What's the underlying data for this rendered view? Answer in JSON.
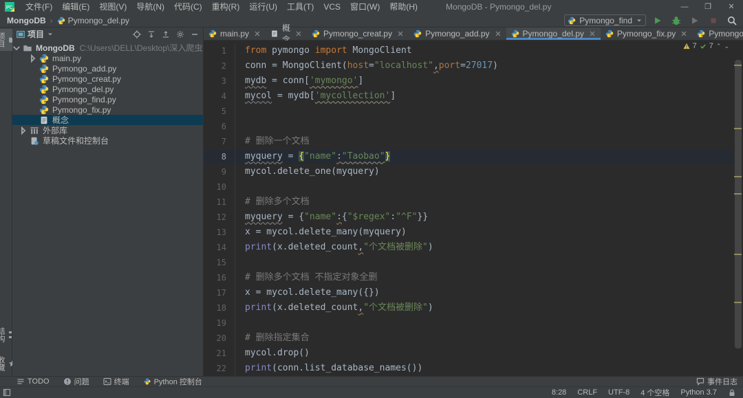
{
  "colors": {
    "accent_blue": "#4a88c7",
    "run_green": "#499c54",
    "selection_blue": "#0d3c52",
    "keyword_orange": "#cc7832",
    "string_green": "#6a8759",
    "number_blue": "#6897bb",
    "builtin_purple": "#8888c6",
    "brace_match_yellow": "#ffef28"
  },
  "titlebar": {
    "title": "MongoDB - Pymongo_del.py",
    "menus": [
      "文件(F)",
      "编辑(E)",
      "视图(V)",
      "导航(N)",
      "代码(C)",
      "重构(R)",
      "运行(U)",
      "工具(T)",
      "VCS",
      "窗口(W)",
      "帮助(H)"
    ],
    "window_controls": {
      "minimize": "—",
      "maximize": "❐",
      "close": "✕"
    }
  },
  "navbar": {
    "crumb_root": "MongoDB",
    "crumb_file": "Pymongo_del.py",
    "run_config": "Pymongo_find"
  },
  "left_stripe": {
    "top": [
      {
        "label": "项目",
        "icon": "folder-icon",
        "active": true
      }
    ],
    "bottom": [
      {
        "label": "结构",
        "icon": "structure-icon"
      },
      {
        "label": "收藏",
        "icon": "star-icon"
      }
    ]
  },
  "project_panel": {
    "header": "项目",
    "tree": [
      {
        "label": "MongoDB",
        "bold": true,
        "path": "C:\\Users\\DELL\\Desktop\\深入爬虫\\爬虫\\MongoDB",
        "icon": "folder-icon",
        "arrow": "down",
        "indent": 2
      },
      {
        "label": "main.py",
        "icon": "python-file-icon",
        "arrow": "right",
        "indent": 26
      },
      {
        "label": "Pymongo_add.py",
        "icon": "python-file-icon",
        "arrow": "none",
        "indent": 26
      },
      {
        "label": "Pymongo_creat.py",
        "icon": "python-file-icon",
        "arrow": "none",
        "indent": 26
      },
      {
        "label": "Pymongo_del.py",
        "icon": "python-file-icon",
        "arrow": "none",
        "indent": 26
      },
      {
        "label": "Pymongo_find.py",
        "icon": "python-file-icon",
        "arrow": "none",
        "indent": 26
      },
      {
        "label": "Pymongo_fix.py",
        "icon": "python-file-icon",
        "arrow": "none",
        "indent": 26
      },
      {
        "label": "概念",
        "icon": "text-file-icon",
        "arrow": "none",
        "indent": 26,
        "selected": true
      },
      {
        "label": "外部库",
        "icon": "library-icon",
        "arrow": "right",
        "indent": 12
      },
      {
        "label": "草稿文件和控制台",
        "icon": "scratch-icon",
        "arrow": "none",
        "indent": 12
      }
    ]
  },
  "tabs": [
    {
      "label": "main.py",
      "icon": "python-file-icon"
    },
    {
      "label": "概念",
      "icon": "text-file-icon"
    },
    {
      "label": "Pymongo_creat.py",
      "icon": "python-file-icon"
    },
    {
      "label": "Pymongo_add.py",
      "icon": "python-file-icon"
    },
    {
      "label": "Pymongo_del.py",
      "icon": "python-file-icon",
      "active": true
    },
    {
      "label": "Pymongo_fix.py",
      "icon": "python-file-icon"
    },
    {
      "label": "Pymongo_find.py",
      "icon": "python-file-icon"
    }
  ],
  "editor": {
    "inspections": {
      "warnings": "7",
      "ok": "7"
    },
    "current_line": 8,
    "scroll_marks_y": [
      35,
      127,
      197,
      222,
      310,
      380
    ],
    "lines": [
      {
        "n": 1,
        "tokens": [
          [
            "k",
            "from"
          ],
          [
            "p",
            " pymongo "
          ],
          [
            "k",
            "import"
          ],
          [
            "p",
            " MongoClient"
          ]
        ]
      },
      {
        "n": 2,
        "tokens": [
          [
            "p",
            "conn = MongoClient("
          ],
          [
            "par",
            "host"
          ],
          [
            "p",
            "="
          ],
          [
            "s",
            "\"localhost\""
          ],
          [
            "pw",
            ","
          ],
          [
            "par",
            "port"
          ],
          [
            "p",
            "="
          ],
          [
            "n",
            "27017"
          ],
          [
            "p",
            ")"
          ]
        ]
      },
      {
        "n": 3,
        "tokens": [
          [
            "u",
            "mydb"
          ],
          [
            "p",
            " = conn["
          ],
          [
            "su",
            "'mymongo'"
          ],
          [
            "p",
            "]"
          ]
        ]
      },
      {
        "n": 4,
        "tokens": [
          [
            "u",
            "mycol"
          ],
          [
            "p",
            " = mydb["
          ],
          [
            "su",
            "'mycollection'"
          ],
          [
            "p",
            "]"
          ]
        ]
      },
      {
        "n": 5,
        "tokens": []
      },
      {
        "n": 6,
        "tokens": []
      },
      {
        "n": 7,
        "tokens": [
          [
            "c",
            "# 删除一个文档"
          ]
        ]
      },
      {
        "n": 8,
        "tokens": [
          [
            "u",
            "myquery"
          ],
          [
            "p",
            " = "
          ],
          [
            "m",
            "{"
          ],
          [
            "s",
            "\"name\""
          ],
          [
            "pw",
            ":"
          ],
          [
            "su",
            "\"Taobao\""
          ],
          [
            "m",
            "}"
          ]
        ]
      },
      {
        "n": 9,
        "tokens": [
          [
            "p",
            "mycol.delete_one(myquery)"
          ]
        ]
      },
      {
        "n": 10,
        "tokens": []
      },
      {
        "n": 11,
        "tokens": [
          [
            "c",
            "# 删除多个文档"
          ]
        ]
      },
      {
        "n": 12,
        "tokens": [
          [
            "u",
            "myquery"
          ],
          [
            "p",
            " = {"
          ],
          [
            "s",
            "\"name\""
          ],
          [
            "pw",
            ":"
          ],
          [
            "p",
            "{"
          ],
          [
            "s",
            "\"$regex\""
          ],
          [
            "p",
            ":"
          ],
          [
            "s",
            "\"^F\""
          ],
          [
            "p",
            "}}"
          ]
        ]
      },
      {
        "n": 13,
        "tokens": [
          [
            "p",
            "x = mycol.delete_many(myquery)"
          ]
        ]
      },
      {
        "n": 14,
        "tokens": [
          [
            "b",
            "print"
          ],
          [
            "p",
            "(x.deleted_count"
          ],
          [
            "pw",
            ","
          ],
          [
            "s",
            "\"个文档被删除\""
          ],
          [
            "p",
            ")"
          ]
        ]
      },
      {
        "n": 15,
        "tokens": []
      },
      {
        "n": 16,
        "tokens": [
          [
            "c",
            "# 删除多个文档 不指定对象全删"
          ]
        ]
      },
      {
        "n": 17,
        "tokens": [
          [
            "p",
            "x = mycol.delete_many({})"
          ]
        ]
      },
      {
        "n": 18,
        "tokens": [
          [
            "b",
            "print"
          ],
          [
            "p",
            "(x.deleted_count"
          ],
          [
            "pw",
            ","
          ],
          [
            "s",
            "\"个文档被删除\""
          ],
          [
            "p",
            ")"
          ]
        ]
      },
      {
        "n": 19,
        "tokens": []
      },
      {
        "n": 20,
        "tokens": [
          [
            "c",
            "# 删除指定集合"
          ]
        ]
      },
      {
        "n": 21,
        "tokens": [
          [
            "p",
            "mycol.drop()"
          ]
        ]
      },
      {
        "n": 22,
        "tokens": [
          [
            "b",
            "print"
          ],
          [
            "p",
            "(conn.list_database_names())"
          ]
        ]
      }
    ]
  },
  "bottom": {
    "tools": [
      {
        "label": "TODO",
        "icon": "todo-icon"
      },
      {
        "label": "问题",
        "icon": "problems-icon"
      },
      {
        "label": "终端",
        "icon": "terminal-icon"
      },
      {
        "label": "Python 控制台",
        "icon": "python-console-icon"
      }
    ],
    "event_log": "事件日志",
    "status": [
      "8:28",
      "CRLF",
      "UTF-8",
      "4 个空格",
      "Python 3.7"
    ]
  }
}
